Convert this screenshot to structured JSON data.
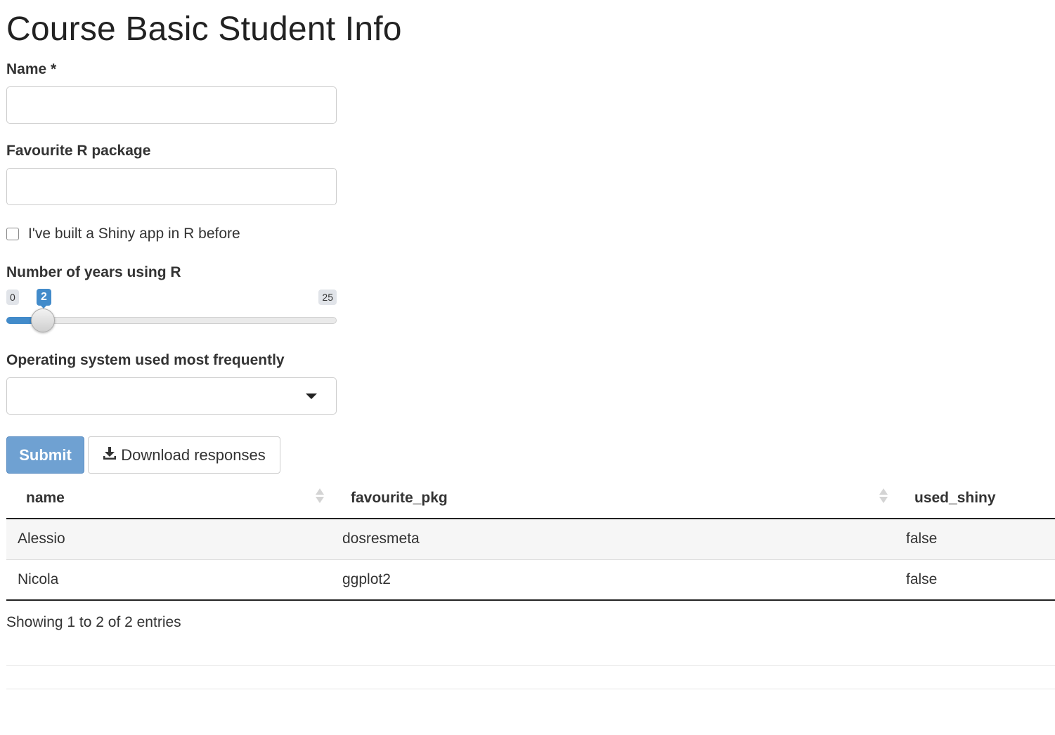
{
  "page": {
    "title": "Course Basic Student Info"
  },
  "form": {
    "name_label": "Name *",
    "name_value": "",
    "pkg_label": "Favourite R package",
    "pkg_value": "",
    "shiny_label": "I've built a Shiny app in R before",
    "shiny_checked": false,
    "years_label": "Number of years using R",
    "years_min": "0",
    "years_max": "25",
    "years_value": "2",
    "os_label": "Operating system used most frequently",
    "os_selected": ""
  },
  "buttons": {
    "submit": "Submit",
    "download": "Download responses",
    "download_icon": "download-icon"
  },
  "table": {
    "columns": [
      "name",
      "favourite_pkg",
      "used_shiny"
    ],
    "rows": [
      [
        "Alessio",
        "dosresmeta",
        "false"
      ],
      [
        "Nicola",
        "ggplot2",
        "false"
      ]
    ],
    "info": "Showing 1 to 2 of 2 entries"
  },
  "colors": {
    "accent": "#428bca",
    "submit_bg": "#6fa1d2"
  }
}
